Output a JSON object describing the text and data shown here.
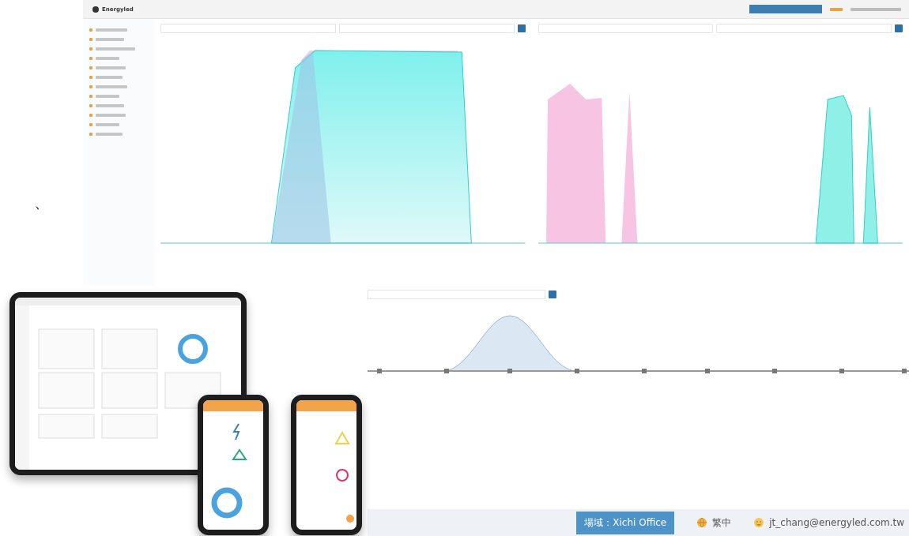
{
  "mark": "、",
  "app": {
    "logo": "Energyled"
  },
  "bottom_bar": {
    "site_button": "場域：Xichi Office",
    "language": "繁中",
    "user": "jt_chang@energyled.com.tw"
  }
}
